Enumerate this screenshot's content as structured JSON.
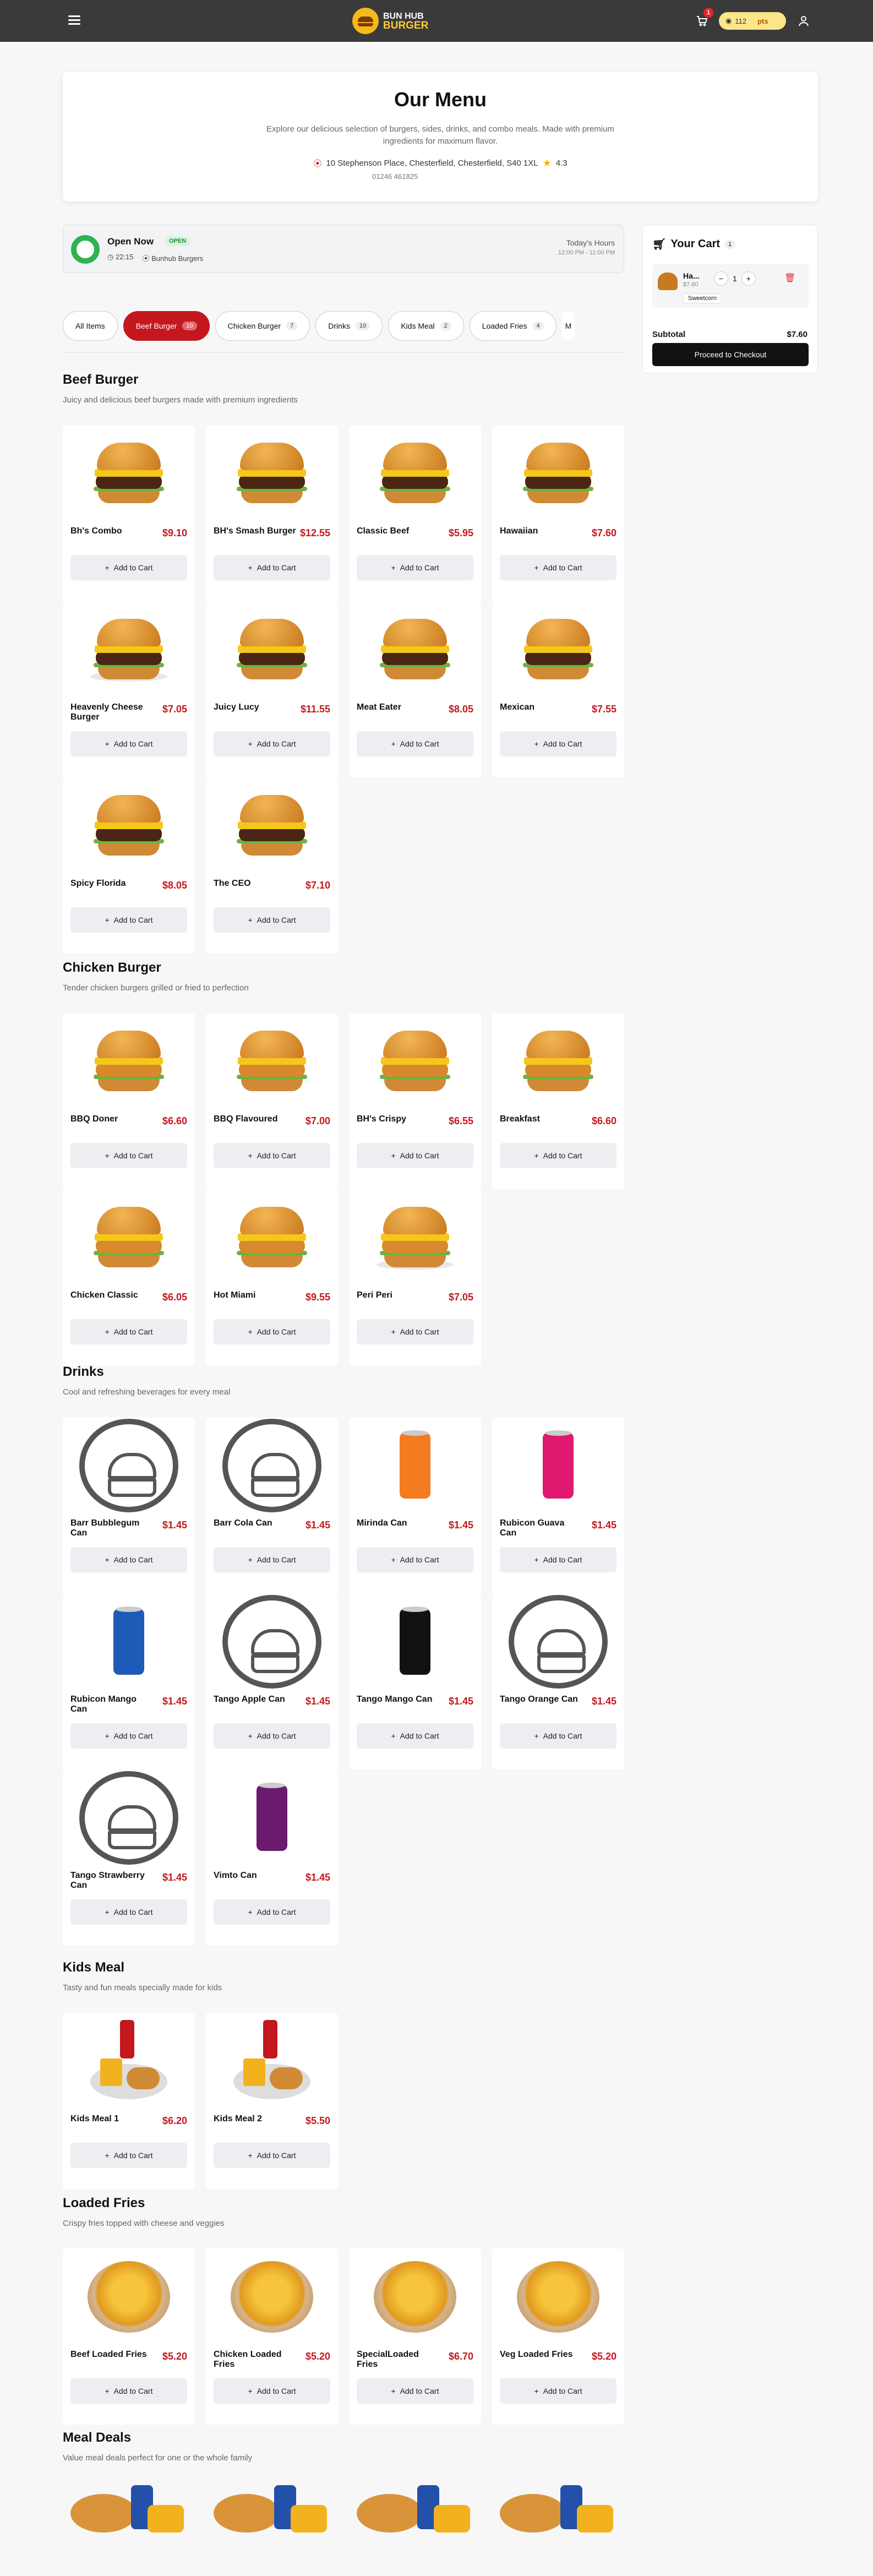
{
  "header": {
    "logo_line1": "BUN HUB",
    "logo_line2": "BURGER",
    "cart_count": "1",
    "points": "112",
    "points_label": "pts"
  },
  "hero": {
    "title": "Our Menu",
    "description": "Explore our delicious selection of burgers, sides, drinks, and combo meals. Made with premium ingredients for maximum flavor.",
    "address": "10 Stephenson Place, Chesterfield, Chesterfield, S40 1XL",
    "rating": "4.3",
    "phone": "01246 461825"
  },
  "status": {
    "open_text": "Open Now",
    "badge": "OPEN",
    "time": "22:15",
    "store": "Bunhub Burgers",
    "hours_label": "Today's Hours",
    "hours": "12:00 PM - 11:00 PM"
  },
  "tabs": [
    {
      "label": "All Items",
      "count": ""
    },
    {
      "label": "Beef Burger",
      "count": "10"
    },
    {
      "label": "Chicken Burger",
      "count": "7"
    },
    {
      "label": "Drinks",
      "count": "10"
    },
    {
      "label": "Kids Meal",
      "count": "2"
    },
    {
      "label": "Loaded Fries",
      "count": "4"
    },
    {
      "label": "M",
      "count": ""
    }
  ],
  "add_label": "Add to Cart",
  "sections": [
    {
      "title": "Beef Burger",
      "subtitle": "Juicy and delicious beef burgers made with premium ingredients",
      "items": [
        {
          "name": "Bh's Combo",
          "price": "$9.10"
        },
        {
          "name": "BH's Smash Burger",
          "price": "$12.55"
        },
        {
          "name": "Classic Beef",
          "price": "$5.95"
        },
        {
          "name": "Hawaiian",
          "price": "$7.60"
        },
        {
          "name": "Heavenly Cheese Burger",
          "price": "$7.05"
        },
        {
          "name": "Juicy Lucy",
          "price": "$11.55"
        },
        {
          "name": "Meat Eater",
          "price": "$8.05"
        },
        {
          "name": "Mexican",
          "price": "$7.55"
        },
        {
          "name": "Spicy Florida",
          "price": "$8.05"
        },
        {
          "name": "The CEO",
          "price": "$7.10"
        }
      ]
    },
    {
      "title": "Chicken Burger",
      "subtitle": "Tender chicken burgers grilled or fried to perfection",
      "items": [
        {
          "name": "BBQ Doner",
          "price": "$6.60"
        },
        {
          "name": "BBQ Flavoured",
          "price": "$7.00"
        },
        {
          "name": "BH's Crispy",
          "price": "$6.55"
        },
        {
          "name": "Breakfast",
          "price": "$6.60"
        },
        {
          "name": "Chicken Classic",
          "price": "$6.05"
        },
        {
          "name": "Hot Miami",
          "price": "$9.55"
        },
        {
          "name": "Peri Peri",
          "price": "$7.05"
        }
      ]
    },
    {
      "title": "Drinks",
      "subtitle": "Cool and refreshing beverages for every meal",
      "items": [
        {
          "name": "Barr Bubblegum Can",
          "price": "$1.45"
        },
        {
          "name": "Barr Cola Can",
          "price": "$1.45"
        },
        {
          "name": "Mirinda Can",
          "price": "$1.45"
        },
        {
          "name": "Rubicon Guava Can",
          "price": "$1.45"
        },
        {
          "name": "Rubicon Mango Can",
          "price": "$1.45"
        },
        {
          "name": "Tango Apple Can",
          "price": "$1.45"
        },
        {
          "name": "Tango Mango Can",
          "price": "$1.45"
        },
        {
          "name": "Tango Orange Can",
          "price": "$1.45"
        },
        {
          "name": "Tango Strawberry Can",
          "price": "$1.45"
        },
        {
          "name": "Vimto Can",
          "price": "$1.45"
        }
      ]
    },
    {
      "title": "Kids Meal",
      "subtitle": "Tasty and fun meals specially made for kids",
      "items": [
        {
          "name": "Kids Meal 1",
          "price": "$6.20"
        },
        {
          "name": "Kids Meal 2",
          "price": "$5.50"
        }
      ]
    },
    {
      "title": "Loaded Fries",
      "subtitle": "Crispy fries topped with cheese and veggies",
      "items": [
        {
          "name": "Beef Loaded Fries",
          "price": "$5.20"
        },
        {
          "name": "Chicken Loaded Fries",
          "price": "$5.20"
        },
        {
          "name": "SpecialLoaded Fries",
          "price": "$6.70"
        },
        {
          "name": "Veg Loaded Fries",
          "price": "$5.20"
        }
      ]
    },
    {
      "title": "Meal Deals",
      "subtitle": "Value meal deals perfect for one or the whole family",
      "items": []
    }
  ],
  "cart": {
    "title": "Your Cart",
    "count": "1",
    "item_name": "Ha...",
    "item_price": "$7.60",
    "qty": "1",
    "option": "Sweetcorn",
    "subtotal_label": "Subtotal",
    "subtotal": "$7.60",
    "checkout": "Proceed to Checkout"
  }
}
